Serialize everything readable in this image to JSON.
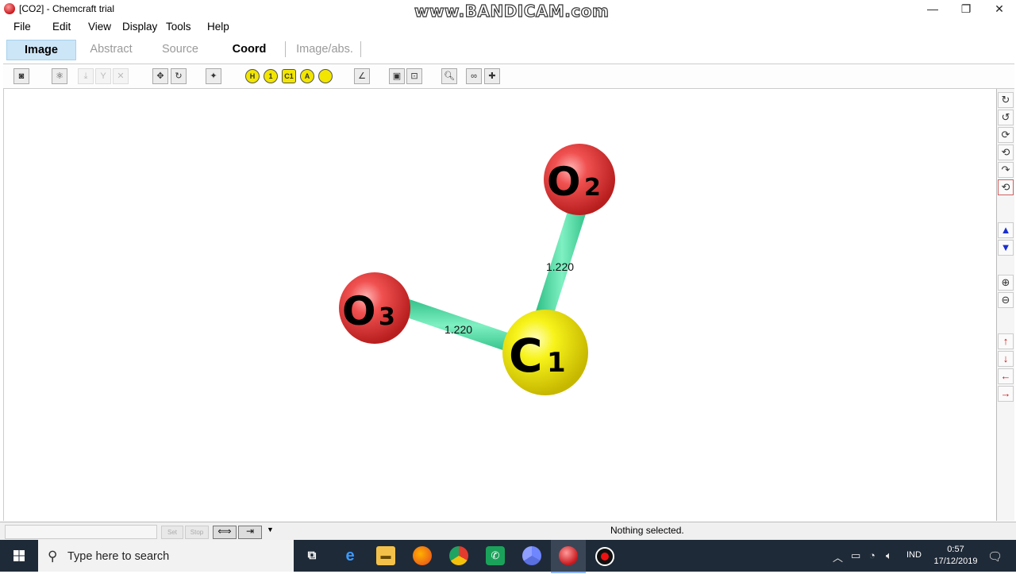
{
  "window": {
    "title": "[CO2] - Chemcraft trial",
    "watermark": "www.BANDICAM.com",
    "controls": [
      "—",
      "❐",
      "✕"
    ]
  },
  "menu": [
    "File",
    "Edit",
    "View",
    "Display",
    "Tools",
    "Help"
  ],
  "tabs": [
    {
      "label": "Image",
      "state": "active"
    },
    {
      "label": "Abstract",
      "state": "dim"
    },
    {
      "label": "Source",
      "state": "dim"
    },
    {
      "label": "Coord",
      "state": "bold"
    },
    {
      "label": "Image/abs.",
      "state": "dim"
    }
  ],
  "toolbar": {
    "icons": [
      "camera-icon",
      "atom-edit-icon",
      "bond-tool-1-icon",
      "bond-tool-2-icon",
      "bond-tool-3-icon",
      "move-icon",
      "rotate-icon",
      "light-icon",
      "hydrogen-icon",
      "info-icon",
      "carbon-label-icon",
      "atom-label-icon",
      "sphere-icon",
      "measure-icon",
      "fit-window-icon",
      "frame-icon",
      "zoom-icon",
      "glasses-icon",
      "add-atom-icon"
    ],
    "yellow_labels": [
      "H",
      "1",
      "C1",
      "A",
      ""
    ]
  },
  "molecule": {
    "atoms": [
      {
        "id": "O2",
        "element": "O",
        "index": "2",
        "color": "#e23b3b"
      },
      {
        "id": "O3",
        "element": "O",
        "index": "3",
        "color": "#e23b3b"
      },
      {
        "id": "C1",
        "element": "C",
        "index": "1",
        "color": "#f2ee0a"
      }
    ],
    "bonds": [
      {
        "from": "C1",
        "to": "O2",
        "length": "1.220"
      },
      {
        "from": "C1",
        "to": "O3",
        "length": "1.220"
      }
    ],
    "bond_color": "#4fe0a4"
  },
  "right_tools": [
    "rotate-cw-icon",
    "rotate-ccw-icon",
    "spin-icon",
    "spin-back-icon",
    "tilt-icon",
    "reset-icon",
    "up-icon",
    "down-icon",
    "zoom-in-icon",
    "zoom-out-icon",
    "move-up-icon",
    "move-down-icon",
    "move-left-icon",
    "move-right-icon"
  ],
  "status": {
    "text": "Nothing selected.",
    "buttons": [
      "Set",
      "Stop",
      "⟺",
      "⇥"
    ]
  },
  "taskbar": {
    "search_placeholder": "Type here to search",
    "language": "IND",
    "time": "0:57",
    "date": "17/12/2019"
  }
}
